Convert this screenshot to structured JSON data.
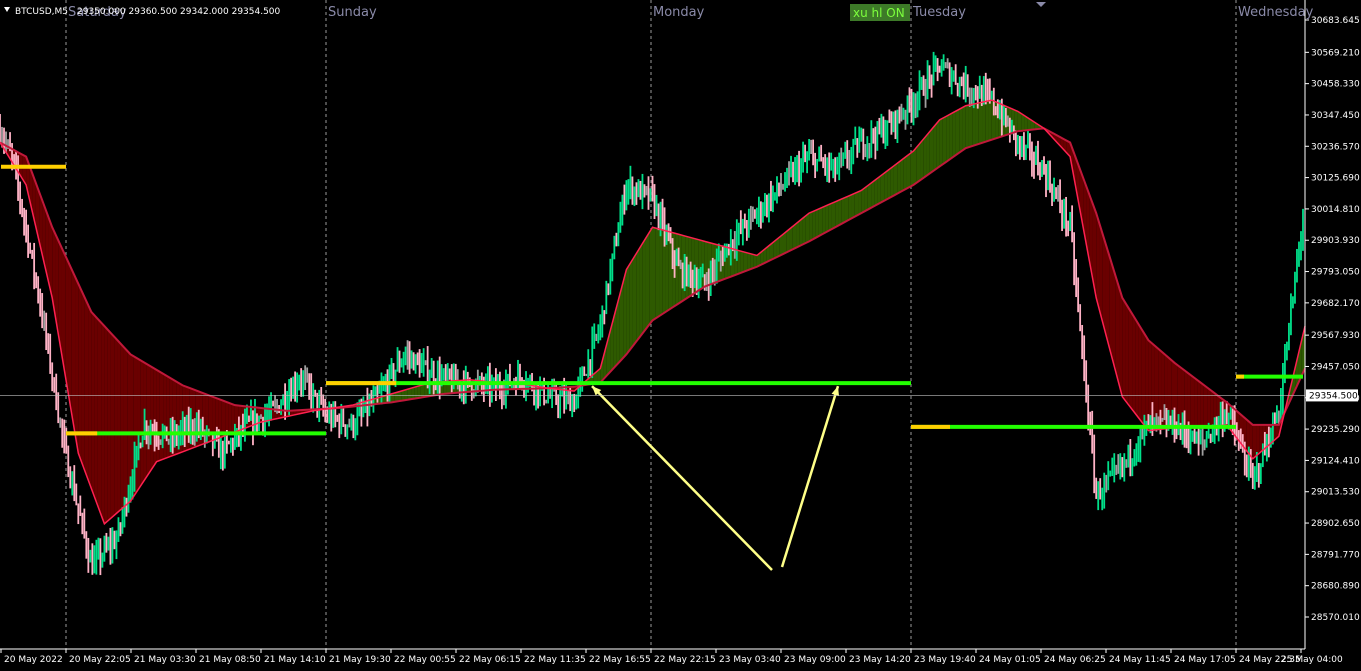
{
  "header": {
    "symbol": "BTCUSD,M5",
    "ohlc": "29350.000 29360.500 29342.000 29354.500",
    "menu_icon": "triangle-down-icon"
  },
  "status_badge": {
    "label": "xu hl ON",
    "bg": "#3d7a28",
    "fg": "#7dff3d"
  },
  "colors": {
    "background": "#000000",
    "up_candle": "#00e08a",
    "down_candle": "#ffb3c6",
    "neutral_candle": "#a0a0a0",
    "bull_fill": "#2e5a00",
    "bear_fill": "#6a0000",
    "fast_ma": "#ff2050",
    "slow_ma_bull": "#3cb371",
    "slow_ma_bear": "#c0183a",
    "level_green": "#22ff00",
    "level_yellow": "#ffd000",
    "arrow": "#ffff88",
    "price_line": "#c0c0c0"
  },
  "chart_data": {
    "type": "line",
    "title": "BTCUSD,M5",
    "y_axis": {
      "min": 28570.01,
      "max": 30683.645,
      "ticks": [
        "30683.645",
        "30569.210",
        "30458.330",
        "30347.450",
        "30236.570",
        "30125.690",
        "30014.810",
        "29903.930",
        "29793.050",
        "29682.170",
        "29567.930",
        "29457.050",
        "29346.170",
        "29235.290",
        "29124.410",
        "29013.530",
        "28902.650",
        "28791.770",
        "28680.890",
        "28570.010"
      ],
      "current_price": "29354.500"
    },
    "x_axis": {
      "ticks": [
        "20 May 2022",
        "20 May 22:05",
        "21 May 03:30",
        "21 May 08:50",
        "21 May 14:10",
        "21 May 19:30",
        "22 May 00:55",
        "22 May 06:15",
        "22 May 11:35",
        "22 May 16:55",
        "22 May 22:15",
        "23 May 03:40",
        "23 May 09:00",
        "23 May 14:20",
        "23 May 19:40",
        "24 May 01:05",
        "24 May 06:25",
        "24 May 11:45",
        "24 May 17:05",
        "24 May 22:35",
        "25 May 04:00"
      ]
    },
    "day_separators": [
      "Saturday",
      "Sunday",
      "Monday",
      "Tuesday",
      "Wednesday"
    ],
    "price_path": {
      "t": [
        0,
        1,
        3,
        5,
        7,
        9,
        11,
        13,
        15,
        17,
        19,
        21,
        23,
        25,
        27,
        29,
        31,
        33,
        35,
        38,
        40,
        42,
        44,
        46,
        48,
        50,
        52,
        54,
        56,
        58,
        60,
        62,
        64,
        66,
        68,
        70,
        72,
        74,
        76,
        78,
        80,
        82,
        84,
        86,
        88,
        90,
        92,
        94,
        96,
        98,
        100
      ],
      "p": [
        30300,
        30180,
        29700,
        29150,
        28750,
        28850,
        29250,
        29200,
        29250,
        29150,
        29250,
        29300,
        29420,
        29280,
        29250,
        29350,
        29500,
        29430,
        29400,
        29380,
        29420,
        29350,
        29330,
        29600,
        30100,
        30050,
        29800,
        29750,
        29900,
        30000,
        30100,
        30200,
        30150,
        30250,
        30300,
        30400,
        30520,
        30450,
        30400,
        30250,
        30150,
        29950,
        29000,
        29100,
        29250,
        29250,
        29180,
        29300,
        29050,
        29300,
        30050
      ]
    },
    "fast_ma": {
      "t": [
        0,
        2,
        4,
        6,
        8,
        10,
        12,
        16,
        20,
        24,
        27,
        30,
        33,
        36,
        38,
        40,
        42,
        44,
        46,
        48,
        50,
        54,
        58,
        62,
        66,
        70,
        72,
        74,
        76,
        78,
        80,
        82,
        84,
        86,
        88,
        90,
        92,
        94,
        96,
        98,
        100
      ],
      "p": [
        30250,
        30100,
        29700,
        29150,
        28900,
        28980,
        29120,
        29190,
        29260,
        29300,
        29320,
        29360,
        29400,
        29410,
        29400,
        29395,
        29380,
        29370,
        29450,
        29800,
        29950,
        29900,
        29850,
        30000,
        30080,
        30220,
        30330,
        30380,
        30400,
        30360,
        30300,
        30200,
        29700,
        29350,
        29230,
        29240,
        29240,
        29250,
        29130,
        29210,
        29600
      ]
    },
    "slow_ma": {
      "t": [
        0,
        2,
        4,
        7,
        10,
        14,
        18,
        22,
        26,
        30,
        34,
        38,
        42,
        44,
        46,
        48,
        50,
        54,
        58,
        62,
        66,
        70,
        74,
        78,
        80,
        82,
        84,
        86,
        88,
        90,
        92,
        94,
        96,
        98,
        100
      ],
      "p": [
        30250,
        30200,
        29950,
        29650,
        29500,
        29390,
        29320,
        29300,
        29310,
        29330,
        29360,
        29375,
        29380,
        29385,
        29400,
        29500,
        29620,
        29740,
        29810,
        29900,
        30000,
        30100,
        30230,
        30290,
        30300,
        30250,
        30000,
        29700,
        29550,
        29470,
        29400,
        29330,
        29250,
        29250,
        29450
      ]
    },
    "levels": [
      {
        "from_label": "20 May 2022",
        "to_label": "20 May 22:05",
        "value": 30164,
        "color": "yellow"
      },
      {
        "from_label": "20 May 22:05",
        "to_label": "21 May 19:30",
        "value": 29220,
        "color": "green"
      },
      {
        "from_label": "21 May 19:30",
        "to_label": "23 May 19:40",
        "value": 29398,
        "color": "green"
      },
      {
        "from_label": "23 May 19:40",
        "to_label": "24 May 22:35",
        "value": 29243,
        "color": "green"
      },
      {
        "from_label": "24 May 22:35",
        "to_label": "25 May 04:00",
        "value": 29421,
        "color": "green"
      }
    ],
    "grid": false,
    "legend": "none"
  }
}
